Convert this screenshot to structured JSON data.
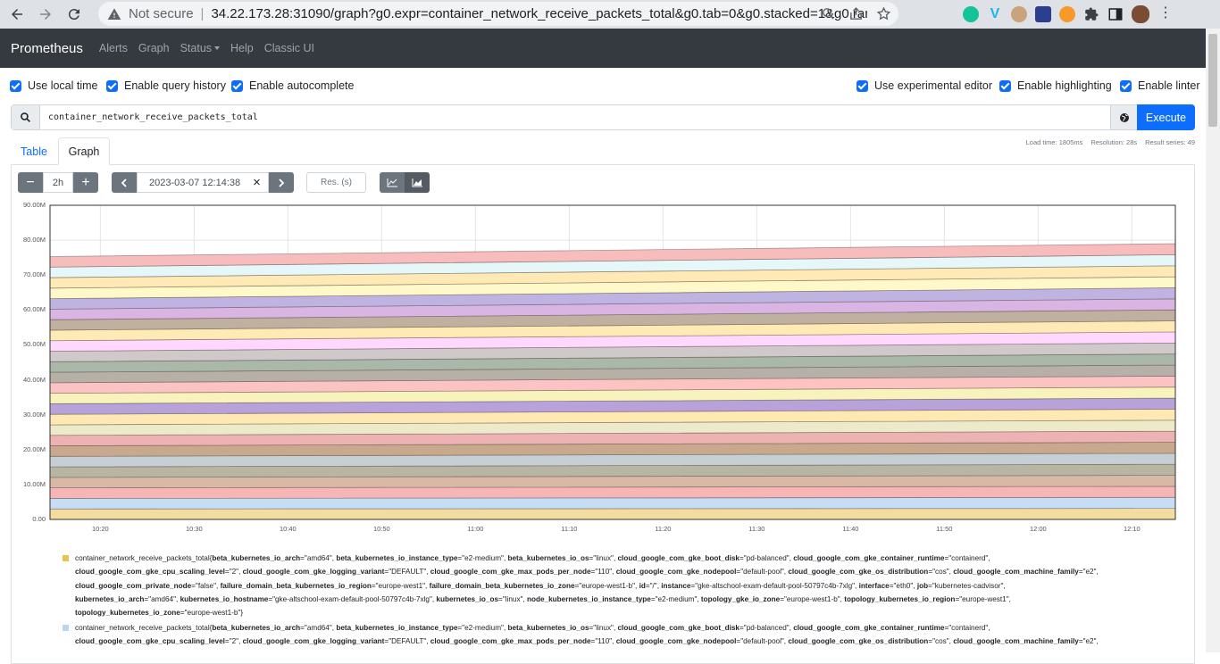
{
  "browser": {
    "not_secure": "Not secure",
    "url": "34.22.173.28:31090/graph?g0.expr=container_network_receive_packets_total&g0.tab=0&g0.stacked=1&g0.range_inp..."
  },
  "nav": {
    "brand": "Prometheus",
    "items": [
      "Alerts",
      "Graph",
      "Status",
      "Help",
      "Classic UI"
    ]
  },
  "options_left": [
    "Use local time",
    "Enable query history",
    "Enable autocomplete"
  ],
  "options_right": [
    "Use experimental editor",
    "Enable highlighting",
    "Enable linter"
  ],
  "query": {
    "value": "container_network_receive_packets_total",
    "execute_label": "Execute"
  },
  "tabs": [
    "Table",
    "Graph"
  ],
  "stats": {
    "load_time": "Load time: 1805ms",
    "resolution": "Resolution: 28s",
    "result_series": "Result series: 49"
  },
  "controls": {
    "minus": "−",
    "range": "2h",
    "plus": "+",
    "end_time": "2023-03-07 12:14:38",
    "clear": "×",
    "resolution_placeholder": "Res. (s)"
  },
  "chart_data": {
    "type": "area",
    "stacked": true,
    "y_ticks": [
      "0.00",
      "10.00M",
      "20.00M",
      "30.00M",
      "40.00M",
      "50.00M",
      "60.00M",
      "70.00M",
      "80.00M",
      "90.00M"
    ],
    "ylim": [
      0,
      90000000
    ],
    "x_ticks": [
      "10:20",
      "10:30",
      "10:40",
      "10:50",
      "11:00",
      "11:10",
      "11:20",
      "11:30",
      "11:40",
      "11:50",
      "12:00",
      "12:10"
    ],
    "x_start": "10:14:38",
    "x_end": "12:14:38",
    "series_count": 49,
    "stack_top_start": 75300000,
    "stack_top_end": 79000000,
    "band_colors": [
      "#f3dca0",
      "#c5ddf5",
      "#f7b6b6",
      "#d9b8a6",
      "#b7b6a3",
      "#c6cfd4",
      "#c8a98e",
      "#edb2b2",
      "#eceac8",
      "#ffe9b3",
      "#b7a3d9",
      "#f8f2bd",
      "#fcc3c3",
      "#b7b0a7",
      "#a9b8a9",
      "#d0c9c9",
      "#ffd7ff",
      "#fdeab4",
      "#c0b09f",
      "#d8b5e3",
      "#bfb3e1",
      "#fff9c9",
      "#ffe9b4",
      "#e6f7f9",
      "#f7bcbc"
    ]
  },
  "legend": [
    {
      "color": "#e6c64f",
      "lines": [
        "container_network_receive_packets_total{beta_kubernetes_io_arch=\"amd64\", beta_kubernetes_io_instance_type=\"e2-medium\", beta_kubernetes_io_os=\"linux\", cloud_google_com_gke_boot_disk=\"pd-balanced\", cloud_google_com_gke_container_runtime=\"containerd\",",
        "cloud_google_com_gke_cpu_scaling_level=\"2\", cloud_google_com_gke_logging_variant=\"DEFAULT\", cloud_google_com_gke_max_pods_per_node=\"110\", cloud_google_com_gke_nodepool=\"default-pool\", cloud_google_com_gke_os_distribution=\"cos\", cloud_google_com_machine_family=\"e2\",",
        "cloud_google_com_private_node=\"false\", failure_domain_beta_kubernetes_io_region=\"europe-west1\", failure_domain_beta_kubernetes_io_zone=\"europe-west1-b\", id=\"/\", instance=\"gke-altschool-exam-default-pool-50797c4b-7xlg\", interface=\"eth0\", job=\"kubernetes-cadvisor\",",
        "kubernetes_io_arch=\"amd64\", kubernetes_io_hostname=\"gke-altschool-exam-default-pool-50797c4b-7xlg\", kubernetes_io_os=\"linux\", node_kubernetes_io_instance_type=\"e2-medium\", topology_gke_io_zone=\"europe-west1-b\", topology_kubernetes_io_region=\"europe-west1\",",
        "topology_kubernetes_io_zone=\"europe-west1-b\"}"
      ]
    },
    {
      "color": "#b6d6f2",
      "lines": [
        "container_network_receive_packets_total{beta_kubernetes_io_arch=\"amd64\", beta_kubernetes_io_instance_type=\"e2-medium\", beta_kubernetes_io_os=\"linux\", cloud_google_com_gke_boot_disk=\"pd-balanced\", cloud_google_com_gke_container_runtime=\"containerd\",",
        "cloud_google_com_gke_cpu_scaling_level=\"2\", cloud_google_com_gke_logging_variant=\"DEFAULT\", cloud_google_com_gke_max_pods_per_node=\"110\", cloud_google_com_gke_nodepool=\"default-pool\", cloud_google_com_gke_os_distribution=\"cos\", cloud_google_com_machine_family=\"e2\","
      ]
    }
  ]
}
